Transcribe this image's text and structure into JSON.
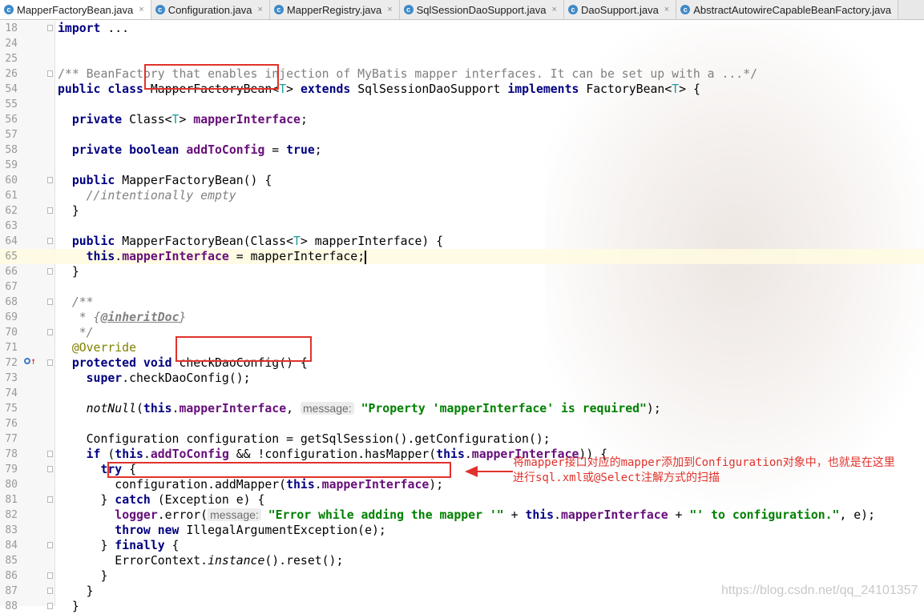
{
  "tabs": [
    {
      "label": "MapperFactoryBean.java",
      "active": true
    },
    {
      "label": "Configuration.java",
      "active": false
    },
    {
      "label": "MapperRegistry.java",
      "active": false
    },
    {
      "label": "SqlSessionDaoSupport.java",
      "active": false
    },
    {
      "label": "DaoSupport.java",
      "active": false
    },
    {
      "label": "AbstractAutowireCapableBeanFactory.java",
      "active": false
    }
  ],
  "tab_icon_letter": "c",
  "tab_close_glyph": "×",
  "colors": {
    "keyword": "#000080",
    "field": "#660e7a",
    "string": "#008000",
    "comment": "#808080",
    "annotation": "#808000",
    "type_param": "#20999d",
    "highlight_box": "#e0322b"
  },
  "lines": {
    "n18": "18",
    "n24": "24",
    "n25": "25",
    "n26": "26",
    "n54": "54",
    "n55": "55",
    "n56": "56",
    "n57": "57",
    "n58": "58",
    "n59": "59",
    "n60": "60",
    "n61": "61",
    "n62": "62",
    "n63": "63",
    "n64": "64",
    "n65": "65",
    "n66": "66",
    "n67": "67",
    "n68": "68",
    "n69": "69",
    "n70": "70",
    "n71": "71",
    "n72": "72",
    "n73": "73",
    "n74": "74",
    "n75": "75",
    "n76": "76",
    "n77": "77",
    "n78": "78",
    "n79": "79",
    "n80": "80",
    "n81": "81",
    "n82": "82",
    "n83": "83",
    "n84": "84",
    "n85": "85",
    "n86": "86",
    "n87": "87",
    "n88": "88"
  },
  "code": {
    "l18_kw": "import",
    "l18_rest": " ...",
    "l26": "/** BeanFactory that enables injection of MyBatis mapper interfaces. It can be set up with a ...*/",
    "l54_kw1": "public class",
    "l54_name": "MapperFactoryBean",
    "l54_lt": "<",
    "l54_T": "T",
    "l54_gt": ">",
    "l54_kw2": " extends",
    "l54_super": " SqlSessionDaoSupport",
    "l54_kw3": " implements",
    "l54_iface": " FactoryBean",
    "l54_lt2": "<",
    "l54_T2": "T",
    "l54_end": "> {",
    "l56_kw": "private",
    "l56_a": " Class<",
    "l56_T": "T",
    "l56_b": "> ",
    "l56_fld": "mapperInterface",
    "l56_end": ";",
    "l58_kw": "private boolean",
    "l58_sp": " ",
    "l58_fld": "addToConfig",
    "l58_eq": " = ",
    "l58_true": "true",
    "l58_end": ";",
    "l60_kw": "public",
    "l60_rest": " MapperFactoryBean() {",
    "l61": "//intentionally empty",
    "l62": "}",
    "l64_kw": "public",
    "l64_a": " MapperFactoryBean(Class<",
    "l64_T": "T",
    "l64_b": "> mapperInterface) {",
    "l65_kw": "this",
    "l65_dot": ".",
    "l65_fld": "mapperInterface",
    "l65_rest": " = mapperInterface;",
    "l66": "}",
    "l68": "/**",
    "l69_a": " * {",
    "l69_tag": "@inheritDoc",
    "l69_b": "}",
    "l70": " */",
    "l71": "@Override",
    "l72_kw": "protected void",
    "l72_sp": " ",
    "l72_name": "checkDaoConfig",
    "l72_end": "() {",
    "l73_kw": "super",
    "l73_rest": ".checkDaoConfig();",
    "l75_fn": "notNull",
    "l75_a": "(",
    "l75_kw": "this",
    "l75_dot": ".",
    "l75_fld": "mapperInterface",
    "l75_b": ", ",
    "l75_hint": "message:",
    "l75_sp": " ",
    "l75_str": "\"Property 'mapperInterface' is required\"",
    "l75_end": ");",
    "l77": "Configuration configuration = getSqlSession().getConfiguration();",
    "l78_kw": "if",
    "l78_a": " (",
    "l78_kw2": "this",
    "l78_dot": ".",
    "l78_fld": "addToConfig",
    "l78_b": " && !configuration.hasMapper(",
    "l78_kw3": "this",
    "l78_dot2": ".",
    "l78_fld2": "mapperInterface",
    "l78_end": ")) {",
    "l79_kw": "try",
    "l79_rest": " {",
    "l80_a": "configuration.addMapper(",
    "l80_kw": "this",
    "l80_dot": ".",
    "l80_fld": "mapperInterface",
    "l80_end": ");",
    "l81_a": "} ",
    "l81_kw": "catch",
    "l81_rest": " (Exception e) {",
    "l82_fld": "logger",
    "l82_a": ".error(",
    "l82_hint": "message:",
    "l82_sp": " ",
    "l82_str": "\"Error while adding the mapper '\"",
    "l82_plus": " + ",
    "l82_kw": "this",
    "l82_dot": ".",
    "l82_fld2": "mapperInterface",
    "l82_plus2": " + ",
    "l82_str2": "\"' to configuration.\"",
    "l82_end": ", e);",
    "l83_kw": "throw new",
    "l83_rest": " IllegalArgumentException(e);",
    "l84_a": "} ",
    "l84_kw": "finally",
    "l84_rest": " {",
    "l85_a": "ErrorContext.",
    "l85_fn": "instance",
    "l85_rest": "().reset();",
    "l86": "}",
    "l87": "}",
    "l88": "}"
  },
  "annotation_note": {
    "line1": "将mapper接口对应的mapper添加到Configuration对象中，也就是在这里",
    "line2": "进行sql.xml或@Select注解方式的扫描"
  },
  "watermark": "https://blog.csdn.net/qq_24101357"
}
